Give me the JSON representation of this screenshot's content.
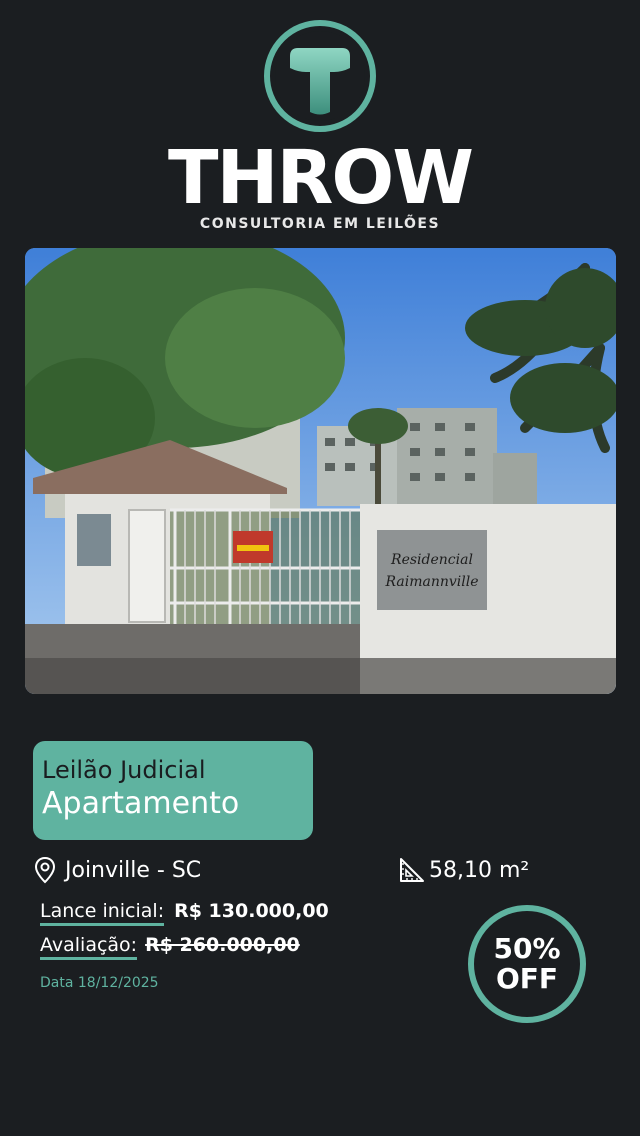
{
  "brand": {
    "logo_letter": "T",
    "name": "THROW",
    "tagline": "CONSULTORIA EM LEILÕES"
  },
  "photo": {
    "sign_line1": "Residencial",
    "sign_line2": "Raimannville"
  },
  "listing": {
    "auction_type": "Leilão Judicial",
    "property_type": "Apartamento",
    "location": "Joinville - SC",
    "area": "58,10 m²",
    "initial_bid_label": "Lance inicial:",
    "initial_bid_value": "R$ 130.000,00",
    "valuation_label": "Avaliação:",
    "valuation_value": "R$ 260.000,00",
    "date": "Data 18/12/2025",
    "discount_line1": "50%",
    "discount_line2": "OFF"
  },
  "icons": {
    "location": "map-pin-icon",
    "area": "set-square-ruler-icon"
  },
  "colors": {
    "background": "#1b1e21",
    "accent": "#5fb3a0",
    "text": "#ffffff"
  }
}
